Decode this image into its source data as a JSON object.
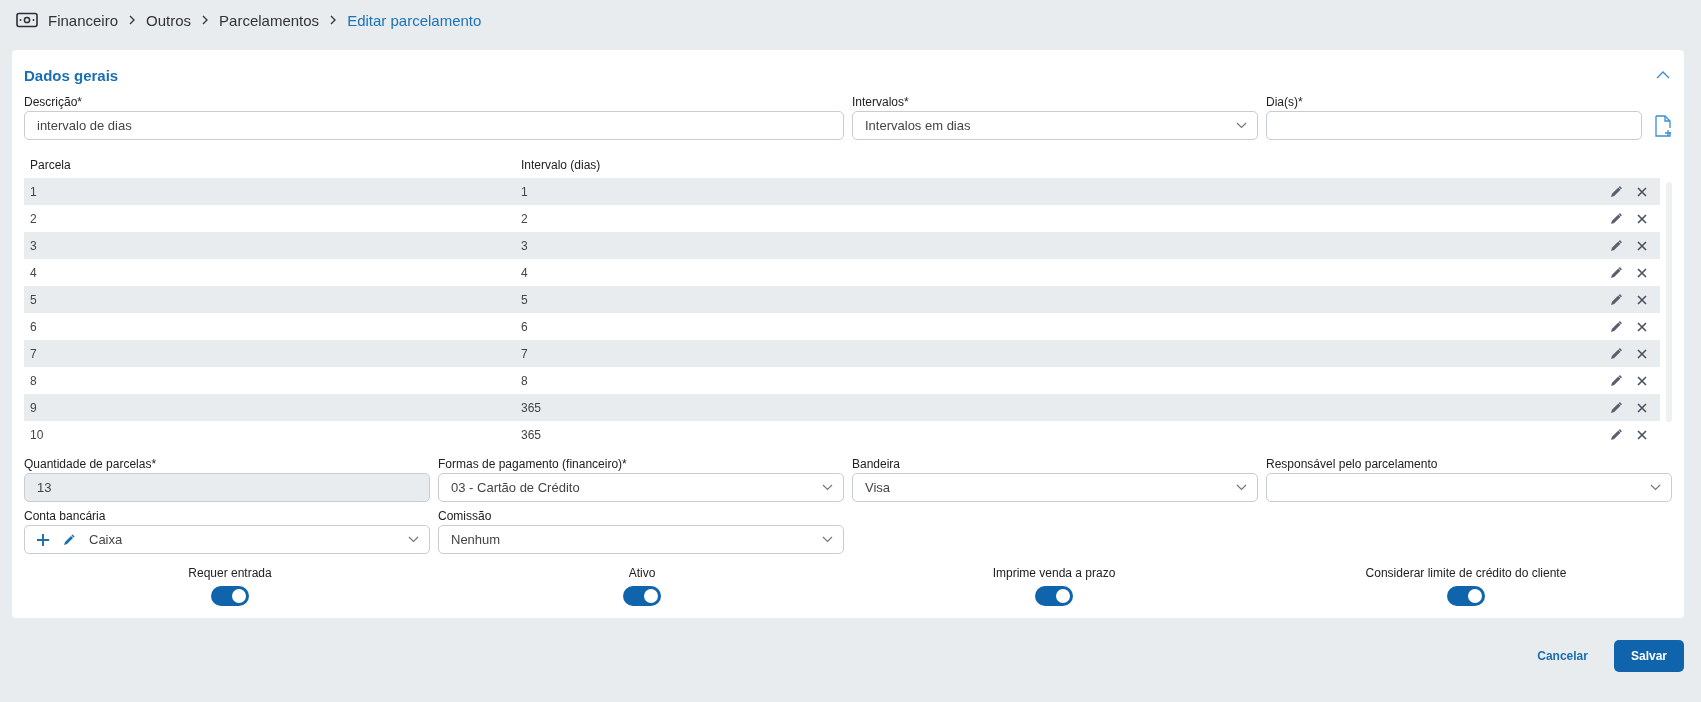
{
  "breadcrumb": [
    {
      "label": "Financeiro",
      "current": false
    },
    {
      "label": "Outros",
      "current": false
    },
    {
      "label": "Parcelamentos",
      "current": false
    },
    {
      "label": "Editar parcelamento",
      "current": true
    }
  ],
  "section": {
    "title": "Dados gerais",
    "expanded": true
  },
  "top_fields": [
    {
      "kind": "text",
      "label": "Descrição*",
      "value": "intervalo de dias"
    },
    {
      "kind": "select",
      "label": "Intervalos*",
      "value": "Intervalos em dias"
    },
    {
      "kind": "text",
      "label": "Dia(s)*"
    }
  ],
  "table": {
    "columns": [
      "Parcela",
      "Intervalo (dias)"
    ],
    "rows": [
      {
        "parcela": "1",
        "intervalo": "1"
      },
      {
        "parcela": "2",
        "intervalo": "2"
      },
      {
        "parcela": "3",
        "intervalo": "3"
      },
      {
        "parcela": "4",
        "intervalo": "4"
      },
      {
        "parcela": "5",
        "intervalo": "5"
      },
      {
        "parcela": "6",
        "intervalo": "6"
      },
      {
        "parcela": "7",
        "intervalo": "7"
      },
      {
        "parcela": "8",
        "intervalo": "8"
      },
      {
        "parcela": "9",
        "intervalo": "365"
      },
      {
        "parcela": "10",
        "intervalo": "365"
      }
    ]
  },
  "fields": [
    {
      "kind": "text",
      "label": "Quantidade de parcelas*",
      "value": "13",
      "disabled": true
    },
    {
      "kind": "select",
      "label": "Formas de pagamento (financeiro)*",
      "value": "03 - Cartão de Crédito",
      "disabled": false
    },
    {
      "kind": "select",
      "label": "Bandeira",
      "value": "Visa",
      "disabled": false
    },
    {
      "kind": "select",
      "label": "Responsável pelo parcelamento",
      "disabled": false
    },
    {
      "kind": "select_actions",
      "label": "Conta bancária",
      "value": "Caixa",
      "disabled": false
    },
    {
      "kind": "select",
      "label": "Comissão",
      "value": "Nenhum",
      "disabled": false
    }
  ],
  "toggles": [
    {
      "label": "Requer entrada",
      "on": true
    },
    {
      "label": "Ativo",
      "on": true
    },
    {
      "label": "Imprime venda a prazo",
      "on": true
    },
    {
      "label": "Considerar limite de crédito do cliente",
      "on": true
    }
  ],
  "buttons": [
    {
      "kind": "link",
      "label": "Cancelar"
    },
    {
      "kind": "primary",
      "label": "Salvar"
    }
  ]
}
